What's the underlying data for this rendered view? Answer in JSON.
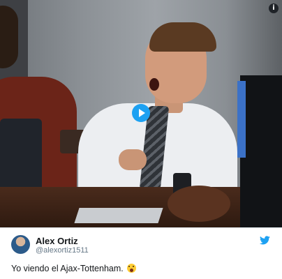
{
  "tweet": {
    "author_name": "Alex Ortiz",
    "author_handle": "@alexortiz1511",
    "text": "Yo viendo el Ajax-Tottenham.",
    "emoji": "screaming-face"
  },
  "media": {
    "type": "video",
    "info_label": "i",
    "play_icon": "play-icon"
  },
  "colors": {
    "twitter_blue": "#1da1f2",
    "text_primary": "#14171a",
    "text_secondary": "#657786"
  }
}
